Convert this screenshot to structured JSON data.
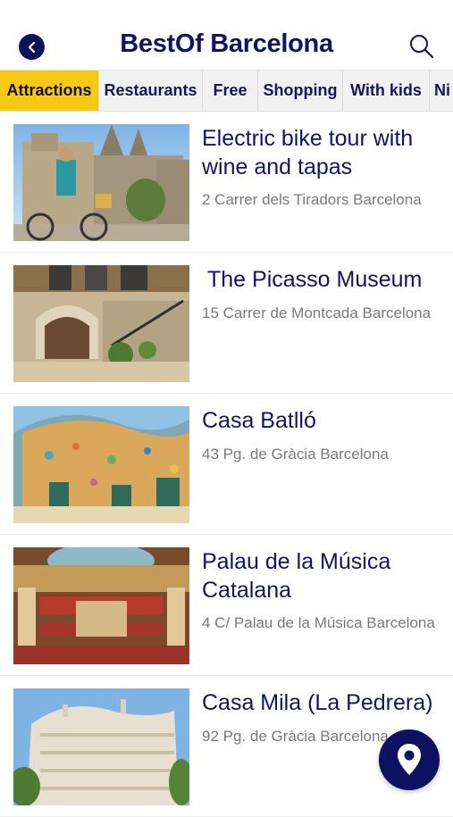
{
  "header": {
    "title": "BestOf Barcelona"
  },
  "tabs": [
    {
      "label": "Attractions",
      "active": true
    },
    {
      "label": "Restaurants",
      "active": false
    },
    {
      "label": "Free",
      "active": false
    },
    {
      "label": "Shopping",
      "active": false
    },
    {
      "label": "With kids",
      "active": false
    },
    {
      "label": "Ni",
      "active": false
    }
  ],
  "items": [
    {
      "name": "Electric bike tour with wine and tapas",
      "address": "2 Carrer dels Tiradors Barcelona"
    },
    {
      "name": "The Picasso Museum",
      "address": "15 Carrer de Montcada Barcelona"
    },
    {
      "name": "Casa Batlló",
      "address": "43 Pg. de Gràcia Barcelona"
    },
    {
      "name": "Palau de la Música Catalana",
      "address": "4 C/ Palau de la Música Barcelona"
    },
    {
      "name": "Casa Mila (La Pedrera)",
      "address": "92 Pg. de Gràcia Barcelona"
    }
  ],
  "colors": {
    "brand": "#0e1160",
    "active_tab": "#f7c912"
  },
  "icons": {
    "back": "chevron-left-icon",
    "search": "search-icon",
    "map": "map-pin-icon"
  }
}
